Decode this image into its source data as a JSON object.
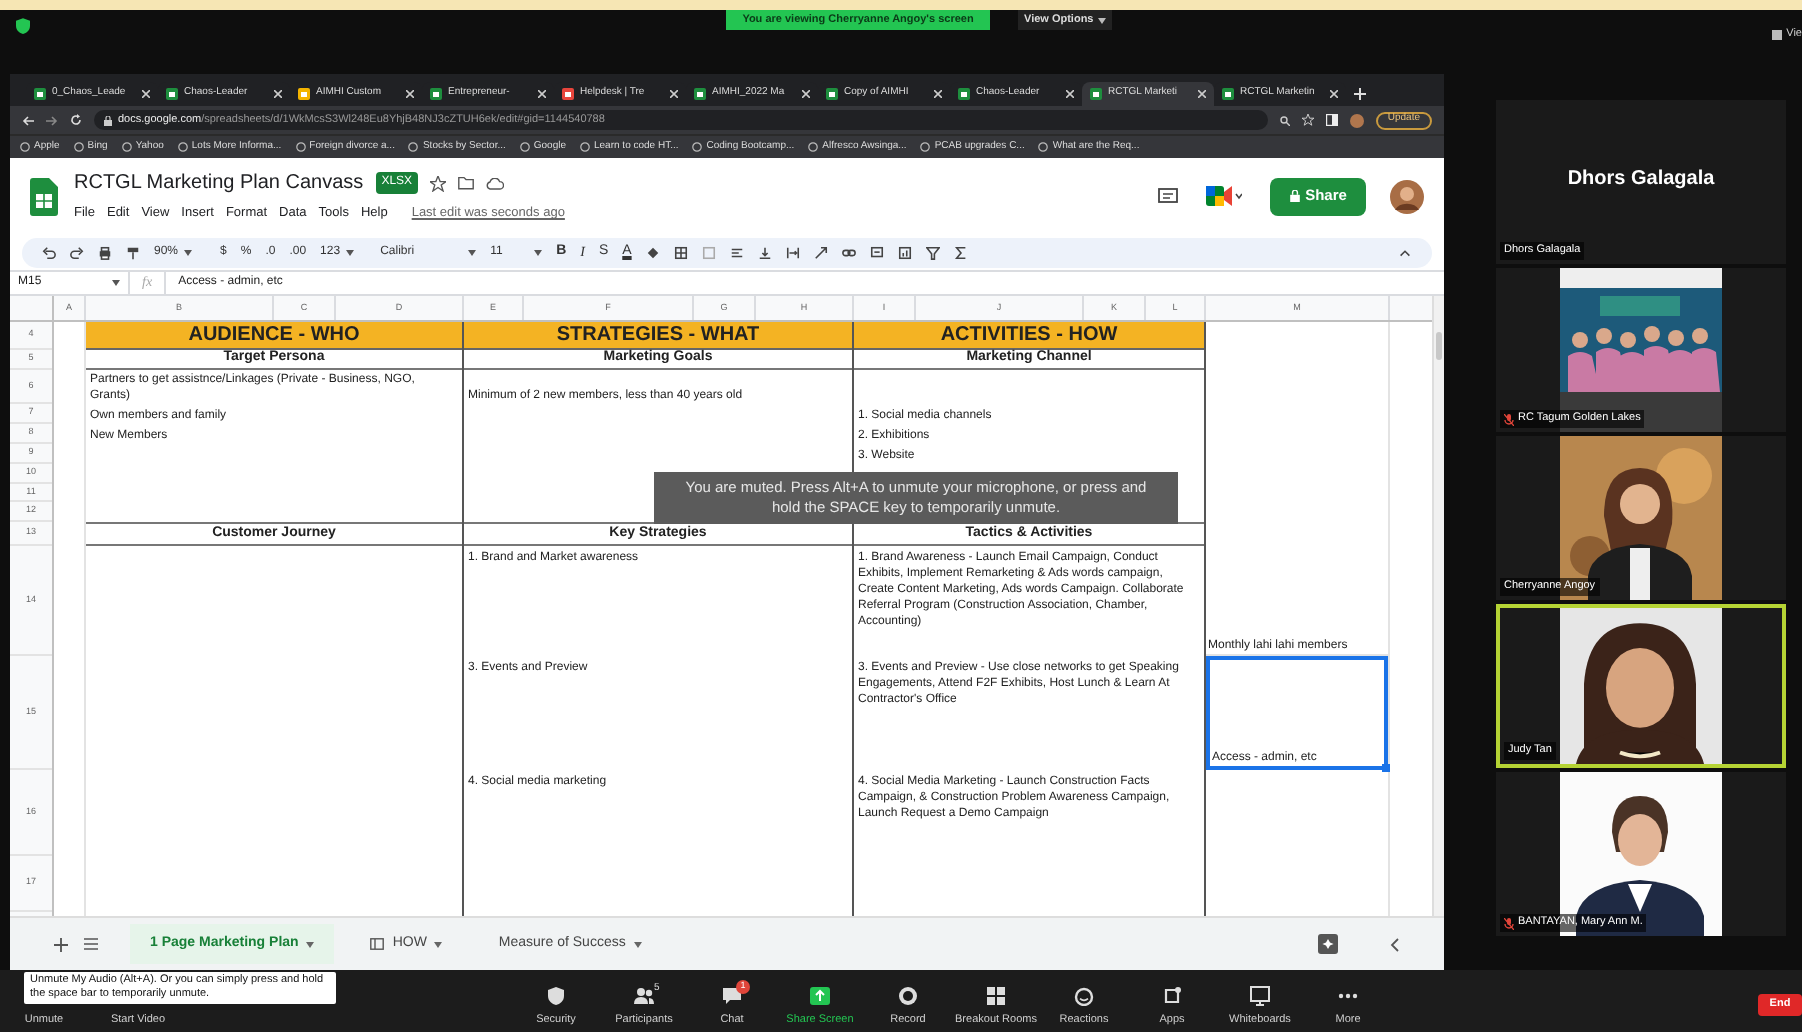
{
  "zoom_top": {
    "banner": "You are viewing Cherryanne Angoy's screen",
    "view_options": "View Options",
    "view_cut": "Vie"
  },
  "browser": {
    "tabs": [
      {
        "title": "0_Chaos_Leade",
        "kind": "sheets",
        "selected": false
      },
      {
        "title": "Chaos-Leader",
        "kind": "sheets",
        "selected": false
      },
      {
        "title": "AIMHI Custom",
        "kind": "slides",
        "selected": false
      },
      {
        "title": "Entrepreneur-",
        "kind": "sheets",
        "selected": false
      },
      {
        "title": "Helpdesk | Tre",
        "kind": "helpdesk",
        "selected": false
      },
      {
        "title": "AIMHI_2022 Ma",
        "kind": "sheets",
        "selected": false
      },
      {
        "title": "Copy of AIMHI",
        "kind": "sheets",
        "selected": false
      },
      {
        "title": "Chaos-Leader",
        "kind": "sheets",
        "selected": false
      },
      {
        "title": "RCTGL Marketi",
        "kind": "sheets",
        "selected": true
      },
      {
        "title": "RCTGL Marketin",
        "kind": "sheets",
        "selected": false
      }
    ],
    "url_host": "docs.google.com",
    "url_path": "/spreadsheets/d/1WkMcsS3Wl248Eu8YhjB48NJ3cZTUH6ek/edit#gid=1144540788",
    "update": "Update",
    "bookmarks": [
      "Apple",
      "Bing",
      "Yahoo",
      "Lots More Informa...",
      "Foreign divorce a...",
      "Stocks by Sector...",
      "Google",
      "Learn to code HT...",
      "Coding Bootcamp...",
      "Alfresco Awsinga...",
      "PCAB upgrades C...",
      "What are the Req..."
    ]
  },
  "sheet": {
    "title": "RCTGL Marketing Plan Canvass",
    "badge": "XLSX",
    "menu": [
      "File",
      "Edit",
      "View",
      "Insert",
      "Format",
      "Data",
      "Tools",
      "Help"
    ],
    "last_edit": "Last edit was seconds ago",
    "share": "Share",
    "toolbar": {
      "zoom": "90%",
      "currency": "$",
      "percent": "%",
      "decrease_decimals": ".0",
      "increase_decimals": ".00",
      "number_format": "123",
      "font": "Calibri",
      "font_size": "11",
      "bold": "B",
      "italic": "I",
      "strikethrough": "S",
      "text_color": "A"
    },
    "name_box": "M15",
    "function_label": "fx",
    "formula": "Access - admin, etc",
    "columns": [
      "A",
      "B",
      "C",
      "D",
      "E",
      "F",
      "G",
      "H",
      "I",
      "J",
      "K",
      "L",
      "M"
    ],
    "rows": [
      "4",
      "5",
      "6",
      "7",
      "8",
      "9",
      "10",
      "11",
      "12",
      "13",
      "14",
      "15",
      "16",
      "17"
    ],
    "sections": [
      {
        "title": "AUDIENCE - WHO",
        "top_heading": "Target Persona",
        "top_lines": [
          "Partners to get assistnce/Linkages (Private - Business, NGO, Grants)",
          "Own members and family",
          "New Members"
        ],
        "bottom_heading": "Customer Journey"
      },
      {
        "title": "STRATEGIES - WHAT",
        "top_heading": "Marketing Goals",
        "top_lines": [
          "Minimum of 2 new members, less than 40 years old"
        ],
        "bottom_heading": "Key Strategies",
        "bottom_items": [
          "1. Brand and Market awareness",
          "3. Events and Preview",
          "4.  Social media marketing"
        ]
      },
      {
        "title": "ACTIVITIES - HOW",
        "top_heading": "Marketing Channel",
        "top_lines": [
          "1. Social media channels",
          "2. Exhibitions",
          "3. Website"
        ],
        "bottom_heading": "Tactics & Activities",
        "bottom_items": [
          "1. Brand Awareness - Launch Email Campaign, Conduct Exhibits, Implement Remarketing & Ads words campaign, Create Content Marketing, Ads words Campaign. Collaborate Referral Program (Construction Association, Chamber, Accounting)",
          "3. Events and Preview - Use close networks to get Speaking Engagements, Attend F2F Exhibits, Host Lunch & Learn At Contractor's Office",
          "4. Social Media Marketing - Launch Construction Facts Campaign, & Construction Problem Awareness Campaign, Launch Request a Demo Campaign"
        ]
      }
    ],
    "side_cells": [
      {
        "text": "Monthly lahi lahi members",
        "selected": false
      },
      {
        "text": "Access - admin, etc",
        "selected": true
      }
    ],
    "sheet_tabs": [
      {
        "label": "1 Page Marketing Plan",
        "selected": true
      },
      {
        "label": "HOW",
        "selected": false
      },
      {
        "label": "Measure of Success",
        "selected": false
      }
    ]
  },
  "muted_notice": "You are muted. Press Alt+A to unmute your microphone, or press and hold the SPACE key to temporarily unmute.",
  "participants": [
    {
      "name": "Dhors Galagala",
      "big_name": "Dhors Galagala",
      "video": false,
      "muted": false,
      "speaking": false
    },
    {
      "name": "RC Tagum Golden Lakes",
      "video": true,
      "muted": true,
      "speaking": false
    },
    {
      "name": "Cherryanne Angoy",
      "video": true,
      "muted": false,
      "speaking": false
    },
    {
      "name": "Judy Tan",
      "video": true,
      "muted": false,
      "speaking": true
    },
    {
      "name": "BANTAYAN, Mary Ann M.",
      "video": true,
      "muted": true,
      "speaking": false
    }
  ],
  "toolbar": [
    {
      "label": "Unmute"
    },
    {
      "label": "Start Video"
    },
    {
      "label": "Security",
      "kind": "shield"
    },
    {
      "label": "Participants",
      "kind": "people",
      "count": "5"
    },
    {
      "label": "Chat",
      "kind": "chat",
      "badge": "1"
    },
    {
      "label": "Share Screen",
      "kind": "share"
    },
    {
      "label": "Record",
      "kind": "record"
    },
    {
      "label": "Breakout Rooms",
      "kind": "grid"
    },
    {
      "label": "Reactions",
      "kind": "smile"
    },
    {
      "label": "Apps",
      "kind": "apps"
    },
    {
      "label": "Whiteboards",
      "kind": "board"
    },
    {
      "label": "More",
      "kind": "more"
    }
  ],
  "unmute_tooltip": "Unmute My Audio (Alt+A). Or you can simply press and hold the space bar to temporarily unmute.",
  "end": "End"
}
